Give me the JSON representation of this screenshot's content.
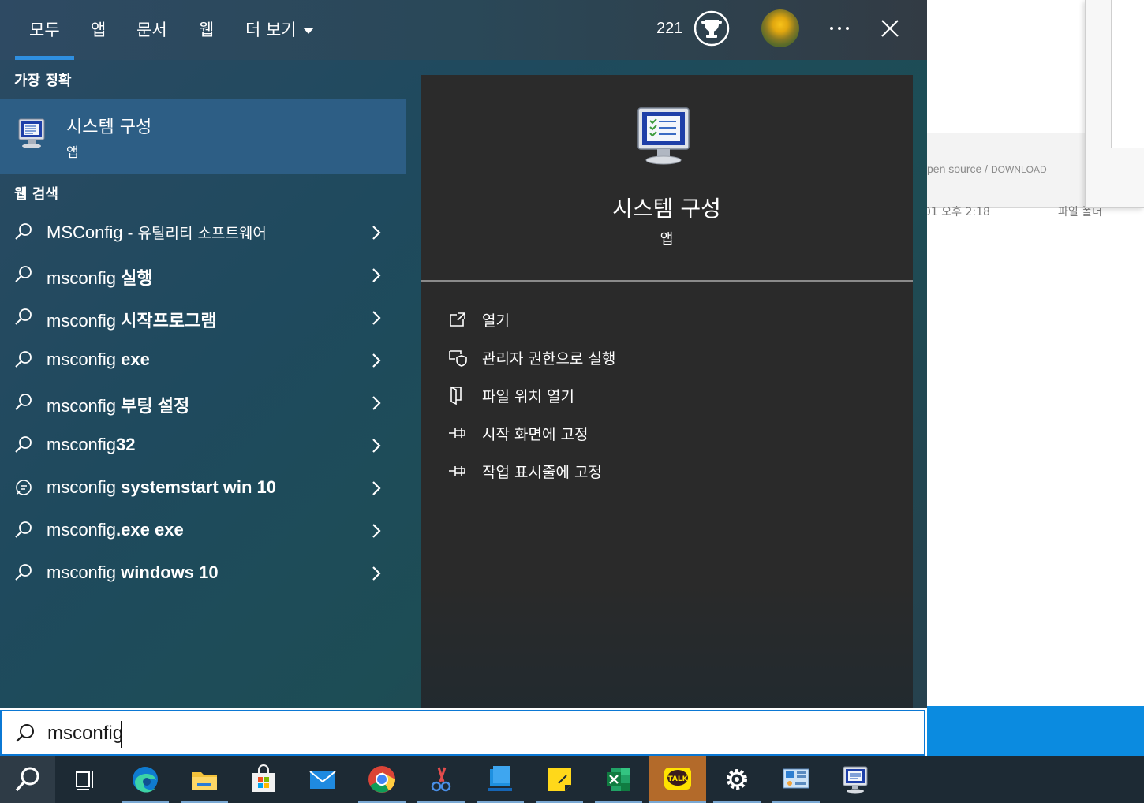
{
  "tabs": [
    {
      "label": "모두",
      "active": true
    },
    {
      "label": "앱"
    },
    {
      "label": "문서"
    },
    {
      "label": "웹"
    },
    {
      "label": "더 보기"
    }
  ],
  "header": {
    "points": "221",
    "trophy_icon": "rewards-trophy-icon",
    "more_icon": "ellipsis-icon",
    "close_icon": "close-icon"
  },
  "best_match": {
    "heading": "가장 정확",
    "name": "시스템 구성",
    "type": "앱",
    "icon": "system-configuration-icon"
  },
  "web_search": {
    "heading": "웹 검색",
    "items": [
      {
        "icon": "search-icon",
        "prefix": "MSConfig",
        "rest": " - 유틸리티 소프트웨어",
        "bold_rest": false
      },
      {
        "icon": "search-icon",
        "prefix": "msconfig",
        "rest": " 실행",
        "bold_rest": true
      },
      {
        "icon": "search-icon",
        "prefix": "msconfig",
        "rest": " 시작프로그램",
        "bold_rest": true
      },
      {
        "icon": "search-icon",
        "prefix": "msconfig",
        "rest": " exe",
        "bold_rest": true
      },
      {
        "icon": "search-icon",
        "prefix": "msconfig",
        "rest": " 부팅 설정",
        "bold_rest": true
      },
      {
        "icon": "search-icon",
        "prefix": "msconfig",
        "rest": "32",
        "bold_rest": true
      },
      {
        "icon": "chat-icon",
        "prefix": "msconfig",
        "rest": " systemstart win 10",
        "bold_rest": true
      },
      {
        "icon": "search-icon",
        "prefix": "msconfig",
        "rest": ".exe exe",
        "bold_rest": true
      },
      {
        "icon": "search-icon",
        "prefix": "msconfig",
        "rest": " windows 10",
        "bold_rest": true
      }
    ]
  },
  "preview": {
    "name": "시스템 구성",
    "type": "앱",
    "actions": [
      {
        "label": "열기",
        "icon": "open-icon"
      },
      {
        "label": "관리자 권한으로 실행",
        "icon": "run-as-admin-icon"
      },
      {
        "label": "파일 위치 열기",
        "icon": "open-file-location-icon"
      },
      {
        "label": "시작 화면에 고정",
        "icon": "pin-to-start-icon"
      },
      {
        "label": "작업 표시줄에 고정",
        "icon": "pin-to-taskbar-icon"
      }
    ]
  },
  "search": {
    "value": "msconfig"
  },
  "background_window": {
    "link_text": "pen source",
    "link_sep": " / ",
    "link_download": "DOWNLOAD",
    "row_time": "01 오후 2:18",
    "row_type": "파일 폴더"
  },
  "taskbar": {
    "apps": [
      "search-icon",
      "task-view-icon",
      "edge-icon",
      "file-explorer-icon",
      "microsoft-store-icon",
      "mail-icon",
      "chrome-icon",
      "snipping-tool-icon",
      "app-blue-icon",
      "sticky-notes-icon",
      "excel-icon",
      "kakaotalk-icon",
      "settings-icon",
      "control-panel-icon",
      "system-configuration-icon"
    ],
    "kakao_label": "TALK"
  },
  "colors": {
    "accent": "#0b78d4",
    "tab_underline": "#2f8fe0",
    "best_match_bg": "#2d5e85",
    "preview_bg": "#2a2a2a",
    "taskbar_bg": "#1d2a34"
  }
}
